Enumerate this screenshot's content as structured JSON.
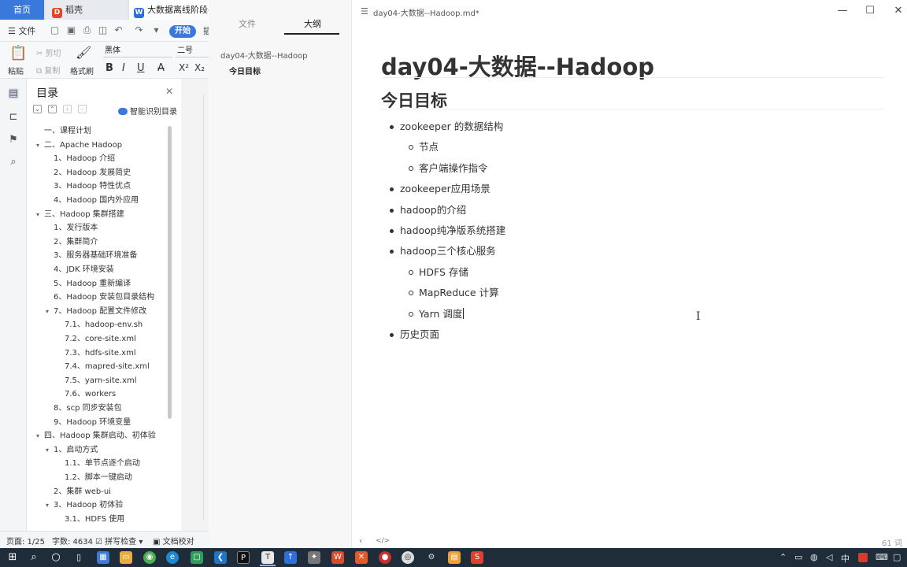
{
  "wps": {
    "tabs": {
      "home": "首页",
      "daoke": "稻壳",
      "doc": "大数据离线阶段--C"
    },
    "menubar": {
      "file": "文件",
      "start": "开始",
      "more": "插"
    },
    "ribbon": {
      "paste": "粘贴",
      "cut": "剪切",
      "copy": "复制",
      "format_painter": "格式刷",
      "font_name": "黑体",
      "font_size": "二号",
      "bold": "B",
      "italic": "I",
      "underline": "U",
      "strike": "A",
      "superscript": "X²",
      "subscript": "X₂"
    },
    "toc": {
      "title": "目录",
      "smart_label": "智能识别目录",
      "items": [
        {
          "label": "一、课程计划",
          "level": 1,
          "caret": ""
        },
        {
          "label": "二、Apache Hadoop",
          "level": 1,
          "caret": "▾"
        },
        {
          "label": "1、Hadoop 介绍",
          "level": 2,
          "caret": ""
        },
        {
          "label": "2、Hadoop 发展简史",
          "level": 2,
          "caret": ""
        },
        {
          "label": "3、Hadoop 特性优点",
          "level": 2,
          "caret": ""
        },
        {
          "label": "4、Hadoop 国内外应用",
          "level": 2,
          "caret": ""
        },
        {
          "label": "三、Hadoop 集群搭建",
          "level": 1,
          "caret": "▾"
        },
        {
          "label": "1、发行版本",
          "level": 2,
          "caret": ""
        },
        {
          "label": "2、集群简介",
          "level": 2,
          "caret": ""
        },
        {
          "label": "3、服务器基础环境准备",
          "level": 2,
          "caret": ""
        },
        {
          "label": "4、JDK 环境安装",
          "level": 2,
          "caret": ""
        },
        {
          "label": "5、Hadoop 重新编译",
          "level": 2,
          "caret": ""
        },
        {
          "label": "6、Hadoop 安装包目录结构",
          "level": 2,
          "caret": ""
        },
        {
          "label": "7、Hadoop 配置文件修改",
          "level": 2,
          "caret": "▾"
        },
        {
          "label": "7.1、hadoop-env.sh",
          "level": 3,
          "caret": ""
        },
        {
          "label": "7.2、core-site.xml",
          "level": 3,
          "caret": ""
        },
        {
          "label": "7.3、hdfs-site.xml",
          "level": 3,
          "caret": ""
        },
        {
          "label": "7.4、mapred-site.xml",
          "level": 3,
          "caret": ""
        },
        {
          "label": "7.5、yarn-site.xml",
          "level": 3,
          "caret": ""
        },
        {
          "label": "7.6、workers",
          "level": 3,
          "caret": ""
        },
        {
          "label": "8、scp 同步安装包",
          "level": 2,
          "caret": ""
        },
        {
          "label": "9、Hadoop 环境变量",
          "level": 2,
          "caret": ""
        },
        {
          "label": "四、Hadoop 集群启动、初体验",
          "level": 1,
          "caret": "▾"
        },
        {
          "label": "1、启动方式",
          "level": 2,
          "caret": "▾"
        },
        {
          "label": "1.1、单节点逐个启动",
          "level": 3,
          "caret": ""
        },
        {
          "label": "1.2、脚本一键启动",
          "level": 3,
          "caret": ""
        },
        {
          "label": "2、集群 web-ui",
          "level": 2,
          "caret": ""
        },
        {
          "label": "3、Hadoop 初体验",
          "level": 2,
          "caret": "▾"
        },
        {
          "label": "3.1、HDFS 使用",
          "level": 3,
          "caret": ""
        }
      ]
    },
    "status": {
      "page": "页面: 1/25",
      "words": "字数: 4634",
      "spell": "拼写检查",
      "proof": "文档校对"
    }
  },
  "typora": {
    "sidebar": {
      "tab_files": "文件",
      "tab_outline": "大纲",
      "outline_root": "day04-大数据--Hadoop",
      "outline_child": "今日目标"
    },
    "filename": "day04-大数据--Hadoop.md*",
    "h1": "day04-大数据--Hadoop",
    "h2": "今日目标",
    "list": [
      {
        "text": "zookeeper 的数据结构",
        "level": 1
      },
      {
        "text": "节点",
        "level": 2
      },
      {
        "text": "客户端操作指令",
        "level": 2
      },
      {
        "text": "zookeeper应用场景",
        "level": 1
      },
      {
        "text": "hadoop的介绍",
        "level": 1
      },
      {
        "text": "hadoop纯净版系统搭建",
        "level": 1
      },
      {
        "text": "hadoop三个核心服务",
        "level": 1
      },
      {
        "text": "HDFS 存储",
        "level": 2
      },
      {
        "text": "MapReduce 计算",
        "level": 2
      },
      {
        "text": "Yarn 调度",
        "level": 2
      },
      {
        "text": "历史页面",
        "level": 1
      }
    ],
    "word_count": "61 词"
  },
  "taskbar": {
    "clock": "中"
  },
  "colors": {
    "wps_blue": "#3a79dc",
    "taskbar": "#1f2d3a"
  }
}
